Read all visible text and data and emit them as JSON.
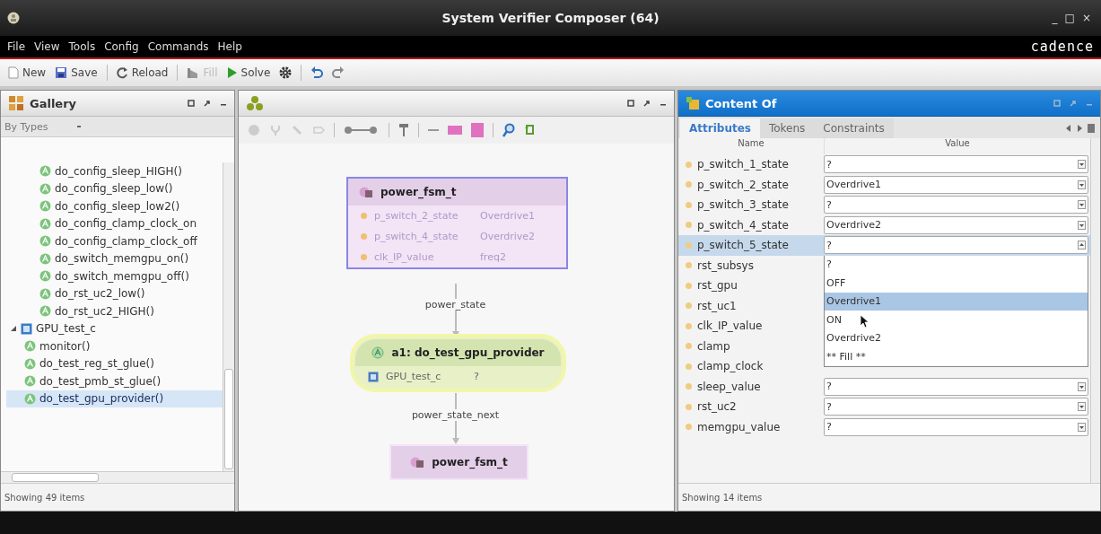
{
  "window": {
    "title": "System Verifier Composer (64)",
    "controls": [
      "_",
      "□",
      "×"
    ]
  },
  "menu": [
    "File",
    "View",
    "Tools",
    "Config",
    "Commands",
    "Help"
  ],
  "brand": "cadence",
  "toolbar": [
    [
      {
        "label": "New",
        "kind": "new"
      },
      {
        "label": "Save",
        "kind": "save"
      }
    ],
    [
      {
        "label": "Reload",
        "kind": "reload"
      }
    ],
    [
      {
        "label": "Fill",
        "kind": "fill",
        "disabled": true
      },
      {
        "label": "Solve",
        "kind": "solve"
      },
      {
        "kind": "gear"
      }
    ],
    [
      {
        "kind": "undo"
      },
      {
        "kind": "redo"
      }
    ]
  ],
  "gallery": {
    "title": "Gallery",
    "filter": "By Types",
    "tree": [
      {
        "label": "do_config_sleep_HIGH()",
        "kind": "action",
        "selected": false
      },
      {
        "label": "do_config_sleep_low()",
        "kind": "action",
        "selected": false
      },
      {
        "label": "do_config_sleep_low2()",
        "kind": "action",
        "selected": false
      },
      {
        "label": "do_config_clamp_clock_on",
        "kind": "action",
        "selected": false
      },
      {
        "label": "do_config_clamp_clock_off",
        "kind": "action",
        "selected": false
      },
      {
        "label": "do_switch_memgpu_on()",
        "kind": "action",
        "selected": false
      },
      {
        "label": "do_switch_memgpu_off()",
        "kind": "action",
        "selected": false
      },
      {
        "label": "do_rst_uc2_low()",
        "kind": "action",
        "selected": false
      },
      {
        "label": "do_rst_uc2_HIGH()",
        "kind": "action",
        "selected": false
      },
      {
        "label": "GPU_test_c",
        "kind": "class",
        "selected": false,
        "expanded": true,
        "children": [
          {
            "label": "monitor()",
            "kind": "action",
            "selected": false
          },
          {
            "label": "do_test_reg_st_glue()",
            "kind": "action",
            "selected": false
          },
          {
            "label": "do_test_pmb_st_glue()",
            "kind": "action",
            "selected": false
          },
          {
            "label": "do_test_gpu_provider()",
            "kind": "action",
            "selected": true
          }
        ]
      }
    ],
    "status": "Showing 49 items"
  },
  "canvas": {
    "nodes": [
      {
        "kind": "type",
        "title": "power_fsm_t",
        "selected": true,
        "fields": [
          {
            "name": "p_switch_2_state",
            "value": "Overdrive1"
          },
          {
            "name": "p_switch_4_state",
            "value": "Overdrive2"
          },
          {
            "name": "clk_IP_value",
            "value": "freq2"
          }
        ]
      },
      {
        "kind": "action",
        "title": "a1: do_test_gpu_provider",
        "selected": false,
        "fields": [
          {
            "name": "GPU_test_c",
            "value": "?"
          }
        ]
      },
      {
        "kind": "type",
        "title": "power_fsm_t",
        "selected": false
      }
    ],
    "edges": [
      {
        "label": "power_state"
      },
      {
        "label": "power_state_next"
      }
    ]
  },
  "content": {
    "title": "Content Of",
    "tabs": [
      {
        "label": "Attributes",
        "selected": true
      },
      {
        "label": "Tokens",
        "selected": false
      },
      {
        "label": "Constraints",
        "selected": false
      }
    ],
    "columns": [
      "Name",
      "Value"
    ],
    "rows": [
      {
        "name": "p_switch_1_state",
        "value": "?",
        "selected": false
      },
      {
        "name": "p_switch_2_state",
        "value": "Overdrive1",
        "selected": false
      },
      {
        "name": "p_switch_3_state",
        "value": "?",
        "selected": false
      },
      {
        "name": "p_switch_4_state",
        "value": "Overdrive2",
        "selected": false
      },
      {
        "name": "p_switch_5_state",
        "value": "?",
        "selected": true
      },
      {
        "name": "rst_subsys",
        "selected": false
      },
      {
        "name": "rst_gpu",
        "selected": false
      },
      {
        "name": "rst_uc1",
        "selected": false
      },
      {
        "name": "clk_IP_value",
        "selected": false
      },
      {
        "name": "clamp",
        "selected": false
      },
      {
        "name": "clamp_clock",
        "selected": false
      },
      {
        "name": "sleep_value",
        "value": "?",
        "selected": false
      },
      {
        "name": "rst_uc2",
        "value": "?",
        "selected": false
      },
      {
        "name": "memgpu_value",
        "value": "?",
        "selected": false
      }
    ],
    "dropdown": {
      "options": [
        {
          "label": "?",
          "selected": false
        },
        {
          "label": "OFF",
          "selected": false
        },
        {
          "label": "Overdrive1",
          "selected": true
        },
        {
          "label": "ON",
          "selected": false
        },
        {
          "label": "Overdrive2",
          "selected": false
        },
        {
          "label": "** Fill **",
          "selected": false
        }
      ]
    },
    "status": "Showing 14 items"
  }
}
